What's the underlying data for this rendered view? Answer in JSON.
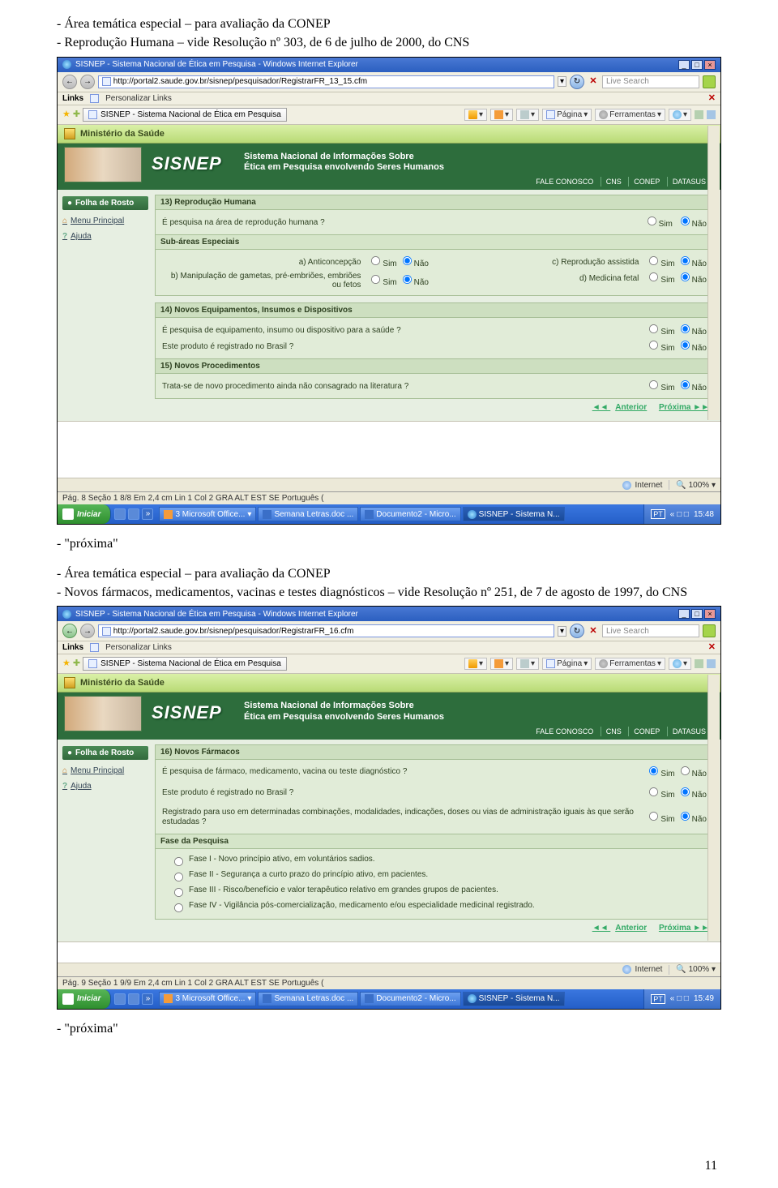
{
  "intro": {
    "l1": "- Área temática especial – para avaliação da CONEP",
    "l2": "- Reprodução Humana – vide Resolução nº 303, de 6 de julho de 2000, do CNS"
  },
  "mid": {
    "l1": "- \"próxima\"",
    "l2": "- Área temática especial – para avaliação da CONEP",
    "l3": "- Novos fármacos, medicamentos, vacinas e testes diagnósticos – vide Resolução nº 251, de 7 de agosto de 1997, do CNS"
  },
  "end": {
    "l1": "- \"próxima\""
  },
  "page_number": "11",
  "shared": {
    "window_title": "SISNEP - Sistema Nacional de Ética em Pesquisa - Windows Internet Explorer",
    "links_label": "Links",
    "links_item": "Personalizar Links",
    "tab_title": "SISNEP - Sistema Nacional de Ética em Pesquisa",
    "search_placeholder": "Live Search",
    "tool_pagina": "Página",
    "tool_ferr": "Ferramentas",
    "ministry": "Ministério da Saúde",
    "sisnep": "SISNEP",
    "subtitle1": "Sistema Nacional de Informações Sobre",
    "subtitle2": "Ética em Pesquisa envolvendo Seres Humanos",
    "menu": [
      "FALE CONOSCO",
      "CNS",
      "CONEP",
      "DATASUS"
    ],
    "folha": "Folha de Rosto",
    "menu_principal": "Menu Principal",
    "ajuda": "Ajuda",
    "sim": "Sim",
    "nao": "Não",
    "anterior": "Anterior",
    "proxima": "Próxima",
    "status_internet": "Internet",
    "status_zoom": "100%",
    "start": "Iniciar",
    "task_office": "3 Microsoft Office...",
    "task_semana": "Semana Letras.doc ...",
    "task_doc2": "Documento2 - Micro...",
    "task_sisnep": "SISNEP - Sistema N...",
    "tray_lang": "PT"
  },
  "shot1": {
    "url": "http://portal2.saude.gov.br/sisnep/pesquisador/RegistrarFR_13_15.cfm",
    "s13_head": "13) Reprodução Humana",
    "s13_q": "É pesquisa na área de reprodução humana ?",
    "sub_head": "Sub-áreas Especiais",
    "sub_a": "a) Anticoncepção",
    "sub_b": "b) Manipulação de gametas, pré-embriões, embriões ou fetos",
    "sub_c": "c) Reprodução assistida",
    "sub_d": "d) Medicina fetal",
    "s14_head": "14) Novos Equipamentos, Insumos e Dispositivos",
    "s14_q1": "É pesquisa de equipamento, insumo ou dispositivo para a saúde ?",
    "s14_q2": "Este produto é registrado no Brasil ?",
    "s15_head": "15) Novos Procedimentos",
    "s15_q": "Trata-se de novo procedimento ainda não consagrado na literatura ?",
    "word_status": "Pág. 8    Seção 1      8/8    Em  2,4 cm   Lin 1    Col 2      GRA  ALT  EST  SE   Português (",
    "clock": "15:48"
  },
  "shot2": {
    "url": "http://portal2.saude.gov.br/sisnep/pesquisador/RegistrarFR_16.cfm",
    "s16_head": "16) Novos Fármacos",
    "q1": "É pesquisa de fármaco, medicamento, vacina ou teste diagnóstico ?",
    "q2": "Este produto é registrado no Brasil ?",
    "q3": "Registrado para uso em determinadas combinações, modalidades, indicações, doses ou vias de administração iguais às que serão estudadas ?",
    "fase_head": "Fase da Pesquisa",
    "f1": "Fase I - Novo princípio ativo, em voluntários sadios.",
    "f2": "Fase II - Segurança a curto prazo do princípio ativo, em pacientes.",
    "f3": "Fase III - Risco/benefício e valor terapêutico relativo em grandes grupos de pacientes.",
    "f4": "Fase IV - Vigilância pós-comercialização, medicamento e/ou especialidade medicinal registrado.",
    "word_status": "Pág. 9    Seção 1      9/9    Em  2,4 cm   Lin 1    Col 2      GRA  ALT  EST  SE   Português (",
    "clock": "15:49"
  }
}
